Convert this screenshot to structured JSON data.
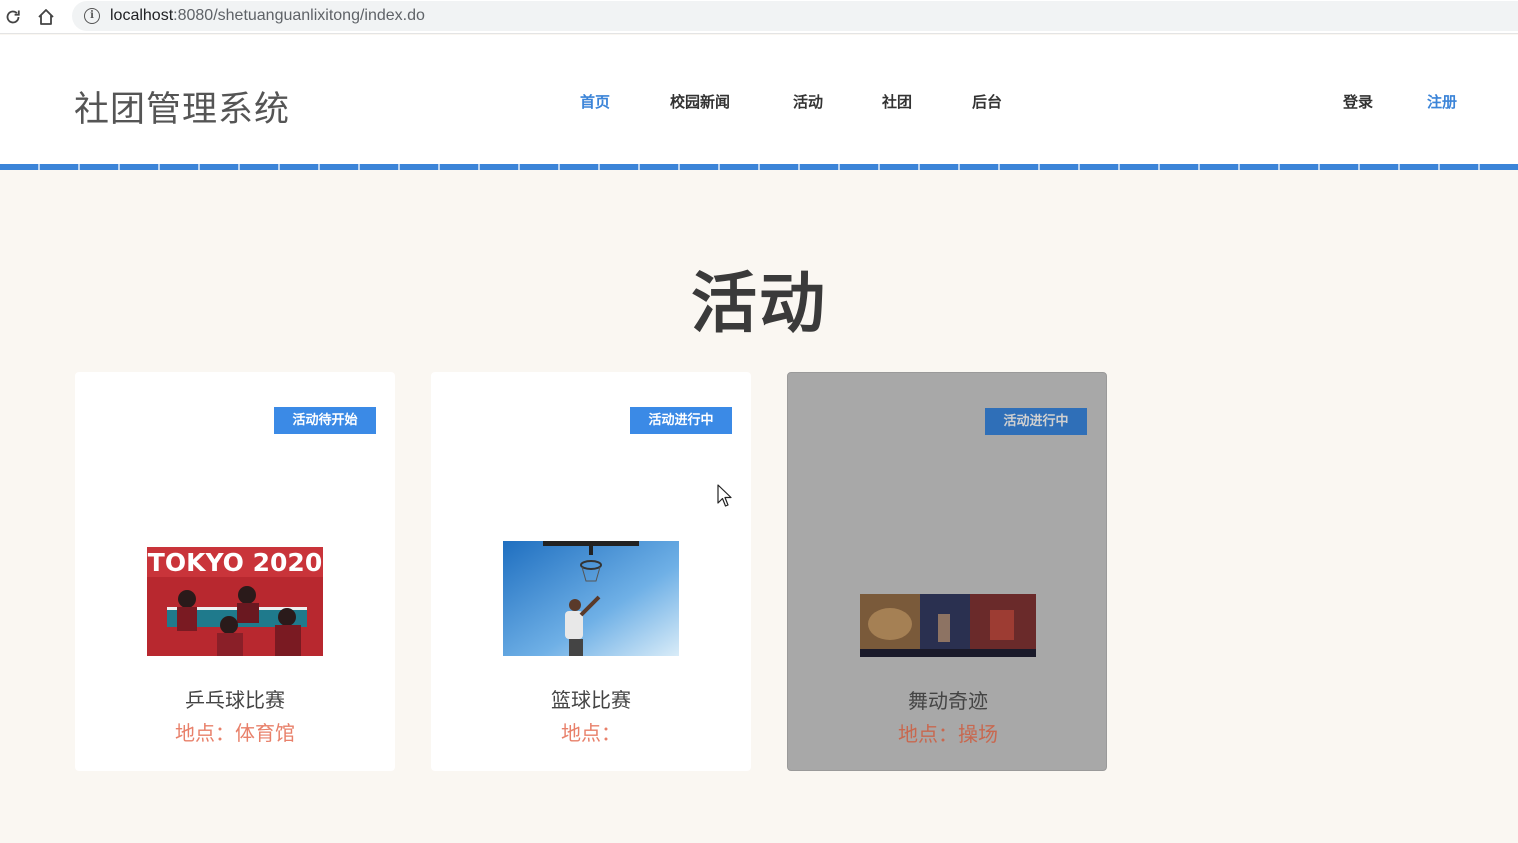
{
  "browser": {
    "url_host": "localhost",
    "url_path": ":8080/shetuanguanlixitong/index.do"
  },
  "header": {
    "logo": "社团管理系统",
    "nav": [
      {
        "label": "首页",
        "active": true
      },
      {
        "label": "校园新闻",
        "active": false
      },
      {
        "label": "活动",
        "active": false
      },
      {
        "label": "社团",
        "active": false
      },
      {
        "label": "后台",
        "active": false
      }
    ],
    "login": "登录",
    "register": "注册"
  },
  "section": {
    "title": "活动"
  },
  "cards": [
    {
      "badge": "活动待开始",
      "name": "乒乓球比赛",
      "location": "地点：体育馆",
      "image": "table-tennis-photo",
      "image_text": "TOKYO 2020"
    },
    {
      "badge": "活动进行中",
      "name": "篮球比赛",
      "location": "地点：",
      "image": "basketball-photo"
    },
    {
      "badge": "活动进行中",
      "name": "舞动奇迹",
      "location": "地点：操场",
      "image": "dance-stage-photo"
    }
  ],
  "colors": {
    "accent": "#3b84d8",
    "badge": "#3b8ae6",
    "location": "#e8806a",
    "page_bg": "#faf7f2"
  }
}
